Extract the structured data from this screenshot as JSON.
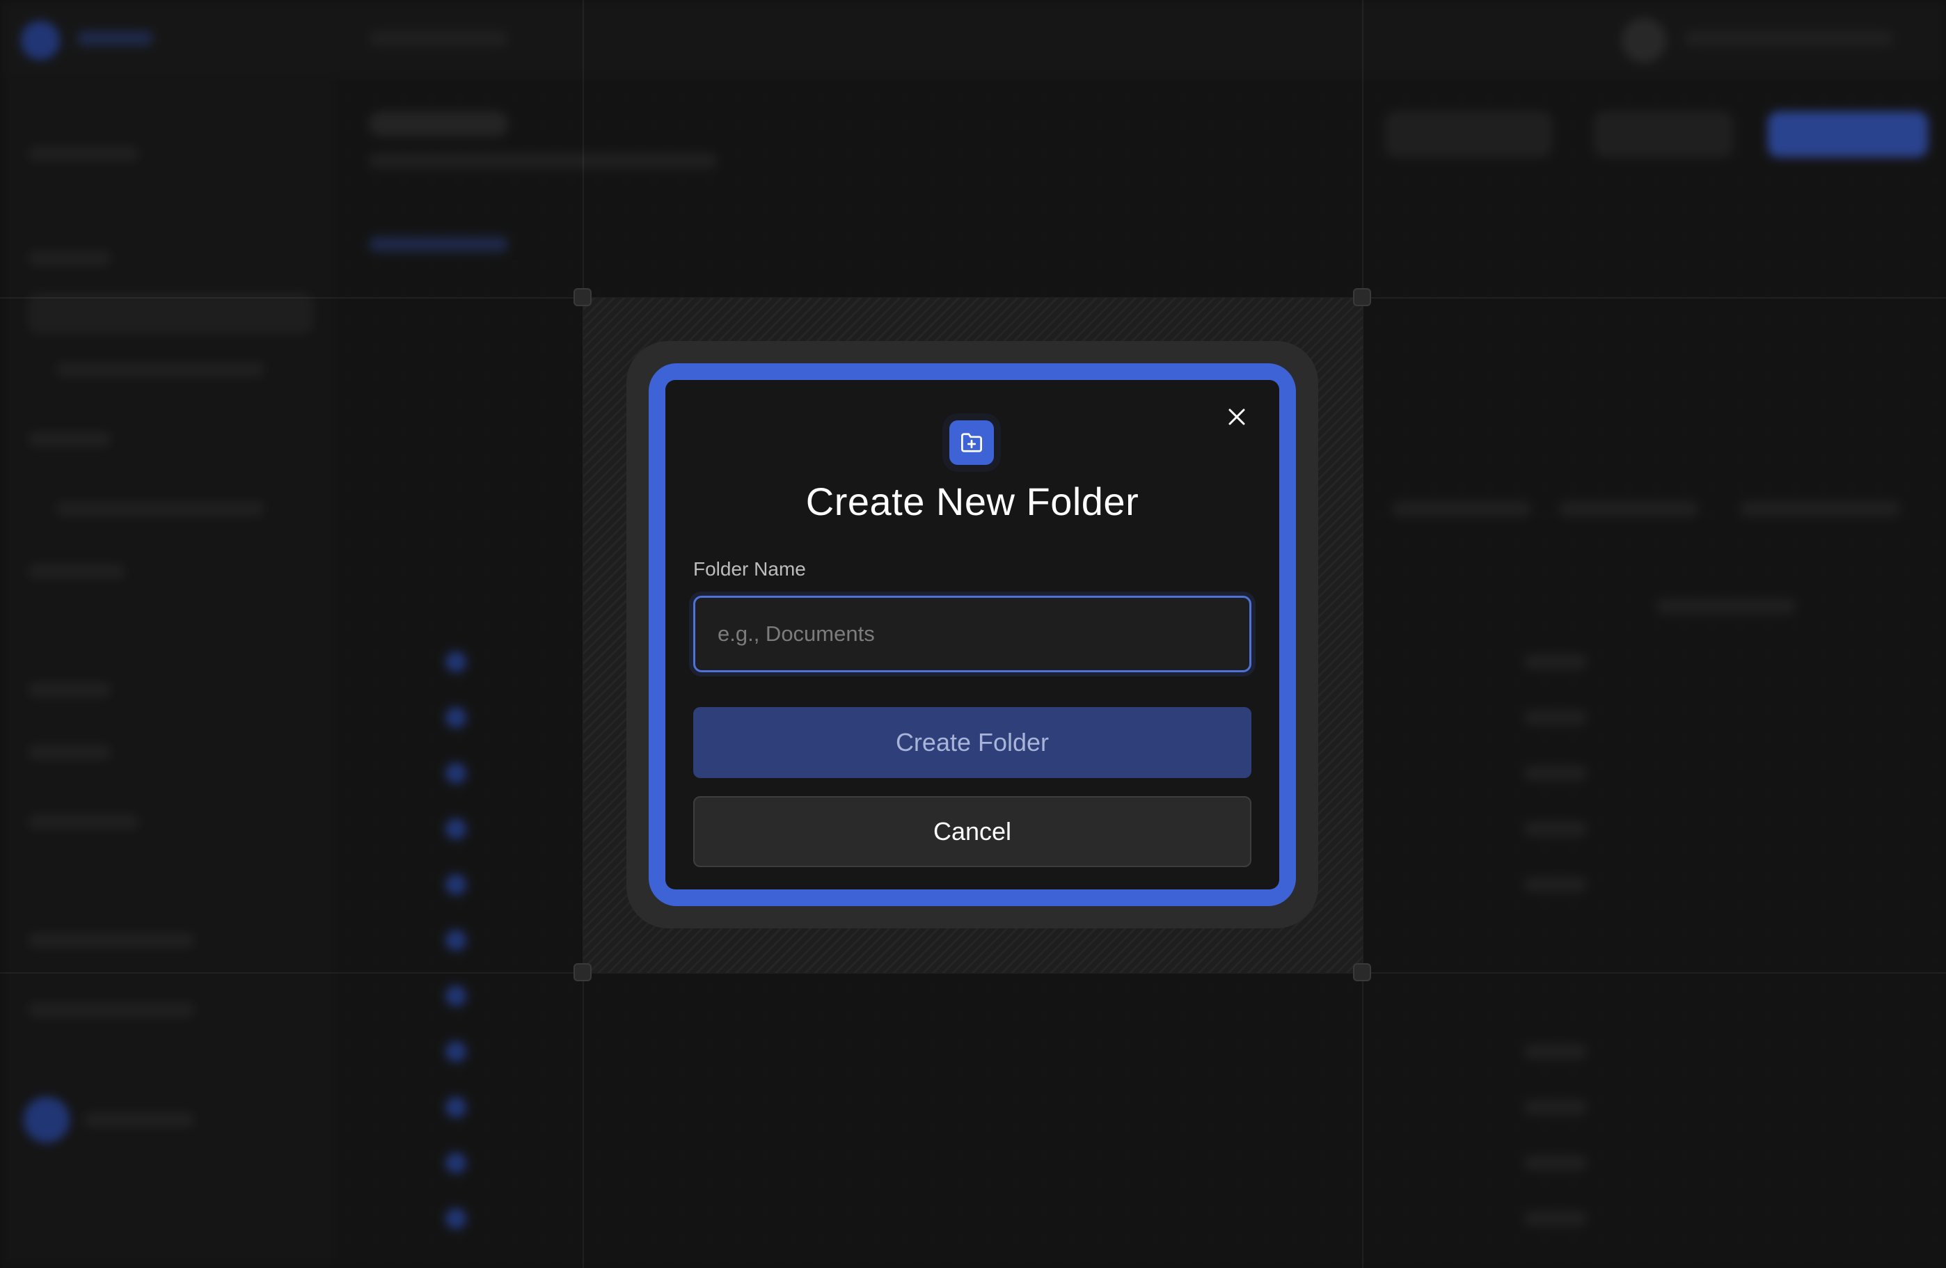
{
  "dialog": {
    "title": "Create New Folder",
    "field_label": "Folder Name",
    "field_value": "",
    "field_placeholder": "e.g., Documents",
    "primary_button": "Create Folder",
    "secondary_button": "Cancel",
    "header_icon": "folder-plus-icon",
    "close_icon": "close-icon"
  },
  "colors": {
    "accent": "#3d63d6",
    "primary_button_bg": "#2e3f7a",
    "modal_bg": "#161616",
    "backdrop": "#1a1a1a"
  }
}
